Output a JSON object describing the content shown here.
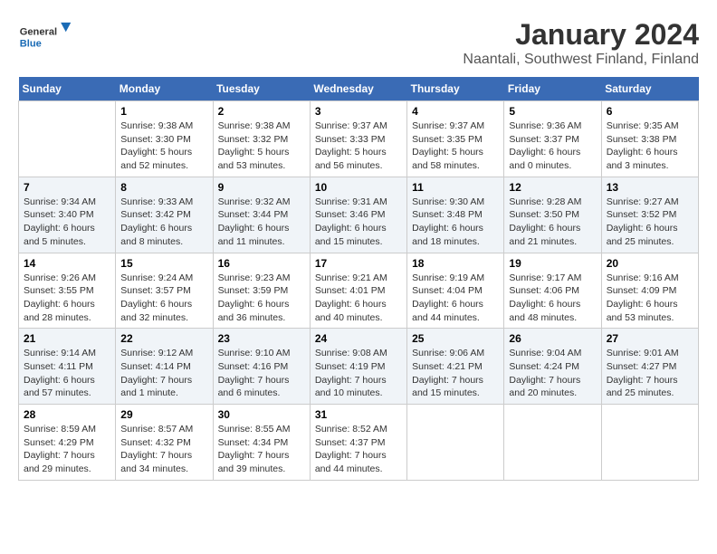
{
  "header": {
    "logo_general": "General",
    "logo_blue": "Blue",
    "title": "January 2024",
    "subtitle": "Naantali, Southwest Finland, Finland"
  },
  "days_of_week": [
    "Sunday",
    "Monday",
    "Tuesday",
    "Wednesday",
    "Thursday",
    "Friday",
    "Saturday"
  ],
  "weeks": [
    [
      {
        "day": "",
        "sunrise": "",
        "sunset": "",
        "daylight": ""
      },
      {
        "day": "1",
        "sunrise": "Sunrise: 9:38 AM",
        "sunset": "Sunset: 3:30 PM",
        "daylight": "Daylight: 5 hours and 52 minutes."
      },
      {
        "day": "2",
        "sunrise": "Sunrise: 9:38 AM",
        "sunset": "Sunset: 3:32 PM",
        "daylight": "Daylight: 5 hours and 53 minutes."
      },
      {
        "day": "3",
        "sunrise": "Sunrise: 9:37 AM",
        "sunset": "Sunset: 3:33 PM",
        "daylight": "Daylight: 5 hours and 56 minutes."
      },
      {
        "day": "4",
        "sunrise": "Sunrise: 9:37 AM",
        "sunset": "Sunset: 3:35 PM",
        "daylight": "Daylight: 5 hours and 58 minutes."
      },
      {
        "day": "5",
        "sunrise": "Sunrise: 9:36 AM",
        "sunset": "Sunset: 3:37 PM",
        "daylight": "Daylight: 6 hours and 0 minutes."
      },
      {
        "day": "6",
        "sunrise": "Sunrise: 9:35 AM",
        "sunset": "Sunset: 3:38 PM",
        "daylight": "Daylight: 6 hours and 3 minutes."
      }
    ],
    [
      {
        "day": "7",
        "sunrise": "Sunrise: 9:34 AM",
        "sunset": "Sunset: 3:40 PM",
        "daylight": "Daylight: 6 hours and 5 minutes."
      },
      {
        "day": "8",
        "sunrise": "Sunrise: 9:33 AM",
        "sunset": "Sunset: 3:42 PM",
        "daylight": "Daylight: 6 hours and 8 minutes."
      },
      {
        "day": "9",
        "sunrise": "Sunrise: 9:32 AM",
        "sunset": "Sunset: 3:44 PM",
        "daylight": "Daylight: 6 hours and 11 minutes."
      },
      {
        "day": "10",
        "sunrise": "Sunrise: 9:31 AM",
        "sunset": "Sunset: 3:46 PM",
        "daylight": "Daylight: 6 hours and 15 minutes."
      },
      {
        "day": "11",
        "sunrise": "Sunrise: 9:30 AM",
        "sunset": "Sunset: 3:48 PM",
        "daylight": "Daylight: 6 hours and 18 minutes."
      },
      {
        "day": "12",
        "sunrise": "Sunrise: 9:28 AM",
        "sunset": "Sunset: 3:50 PM",
        "daylight": "Daylight: 6 hours and 21 minutes."
      },
      {
        "day": "13",
        "sunrise": "Sunrise: 9:27 AM",
        "sunset": "Sunset: 3:52 PM",
        "daylight": "Daylight: 6 hours and 25 minutes."
      }
    ],
    [
      {
        "day": "14",
        "sunrise": "Sunrise: 9:26 AM",
        "sunset": "Sunset: 3:55 PM",
        "daylight": "Daylight: 6 hours and 28 minutes."
      },
      {
        "day": "15",
        "sunrise": "Sunrise: 9:24 AM",
        "sunset": "Sunset: 3:57 PM",
        "daylight": "Daylight: 6 hours and 32 minutes."
      },
      {
        "day": "16",
        "sunrise": "Sunrise: 9:23 AM",
        "sunset": "Sunset: 3:59 PM",
        "daylight": "Daylight: 6 hours and 36 minutes."
      },
      {
        "day": "17",
        "sunrise": "Sunrise: 9:21 AM",
        "sunset": "Sunset: 4:01 PM",
        "daylight": "Daylight: 6 hours and 40 minutes."
      },
      {
        "day": "18",
        "sunrise": "Sunrise: 9:19 AM",
        "sunset": "Sunset: 4:04 PM",
        "daylight": "Daylight: 6 hours and 44 minutes."
      },
      {
        "day": "19",
        "sunrise": "Sunrise: 9:17 AM",
        "sunset": "Sunset: 4:06 PM",
        "daylight": "Daylight: 6 hours and 48 minutes."
      },
      {
        "day": "20",
        "sunrise": "Sunrise: 9:16 AM",
        "sunset": "Sunset: 4:09 PM",
        "daylight": "Daylight: 6 hours and 53 minutes."
      }
    ],
    [
      {
        "day": "21",
        "sunrise": "Sunrise: 9:14 AM",
        "sunset": "Sunset: 4:11 PM",
        "daylight": "Daylight: 6 hours and 57 minutes."
      },
      {
        "day": "22",
        "sunrise": "Sunrise: 9:12 AM",
        "sunset": "Sunset: 4:14 PM",
        "daylight": "Daylight: 7 hours and 1 minute."
      },
      {
        "day": "23",
        "sunrise": "Sunrise: 9:10 AM",
        "sunset": "Sunset: 4:16 PM",
        "daylight": "Daylight: 7 hours and 6 minutes."
      },
      {
        "day": "24",
        "sunrise": "Sunrise: 9:08 AM",
        "sunset": "Sunset: 4:19 PM",
        "daylight": "Daylight: 7 hours and 10 minutes."
      },
      {
        "day": "25",
        "sunrise": "Sunrise: 9:06 AM",
        "sunset": "Sunset: 4:21 PM",
        "daylight": "Daylight: 7 hours and 15 minutes."
      },
      {
        "day": "26",
        "sunrise": "Sunrise: 9:04 AM",
        "sunset": "Sunset: 4:24 PM",
        "daylight": "Daylight: 7 hours and 20 minutes."
      },
      {
        "day": "27",
        "sunrise": "Sunrise: 9:01 AM",
        "sunset": "Sunset: 4:27 PM",
        "daylight": "Daylight: 7 hours and 25 minutes."
      }
    ],
    [
      {
        "day": "28",
        "sunrise": "Sunrise: 8:59 AM",
        "sunset": "Sunset: 4:29 PM",
        "daylight": "Daylight: 7 hours and 29 minutes."
      },
      {
        "day": "29",
        "sunrise": "Sunrise: 8:57 AM",
        "sunset": "Sunset: 4:32 PM",
        "daylight": "Daylight: 7 hours and 34 minutes."
      },
      {
        "day": "30",
        "sunrise": "Sunrise: 8:55 AM",
        "sunset": "Sunset: 4:34 PM",
        "daylight": "Daylight: 7 hours and 39 minutes."
      },
      {
        "day": "31",
        "sunrise": "Sunrise: 8:52 AM",
        "sunset": "Sunset: 4:37 PM",
        "daylight": "Daylight: 7 hours and 44 minutes."
      },
      {
        "day": "",
        "sunrise": "",
        "sunset": "",
        "daylight": ""
      },
      {
        "day": "",
        "sunrise": "",
        "sunset": "",
        "daylight": ""
      },
      {
        "day": "",
        "sunrise": "",
        "sunset": "",
        "daylight": ""
      }
    ]
  ]
}
